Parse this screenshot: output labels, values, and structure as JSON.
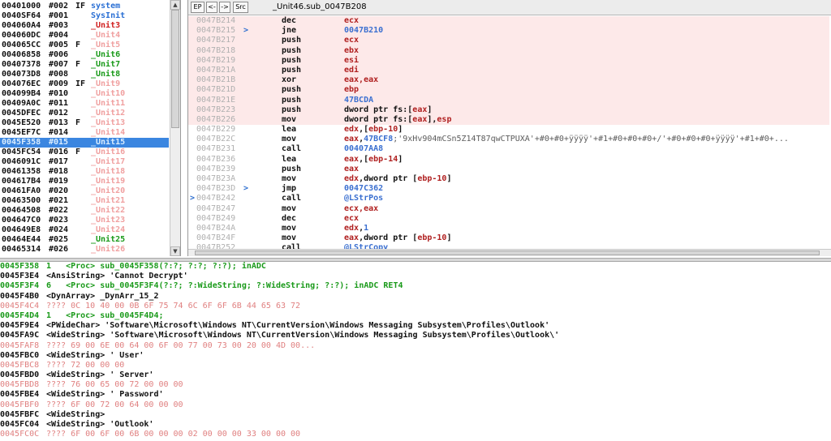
{
  "units": [
    {
      "addr": "00401000",
      "num": "#002",
      "flag": "IF",
      "name": "system",
      "color": "#2a6fd4"
    },
    {
      "addr": "0040SF64",
      "num": "#001",
      "flag": "",
      "name": "SysInit",
      "color": "#2a6fd4"
    },
    {
      "addr": "004060A4",
      "num": "#003",
      "flag": "",
      "name": "_Unit3",
      "color": "#d02020"
    },
    {
      "addr": "004060DC",
      "num": "#004",
      "flag": "",
      "name": "_Unit4",
      "color": "#f0a0a0"
    },
    {
      "addr": "004065CC",
      "num": "#005",
      "flag": "F",
      "name": "_Unit5",
      "color": "#f0a0a0"
    },
    {
      "addr": "00406858",
      "num": "#006",
      "flag": "",
      "name": "_Unit6",
      "color": "#1a9a1a"
    },
    {
      "addr": "00407378",
      "num": "#007",
      "flag": "F",
      "name": "_Unit7",
      "color": "#1a9a1a"
    },
    {
      "addr": "004073D8",
      "num": "#008",
      "flag": "",
      "name": "_Unit8",
      "color": "#1a9a1a"
    },
    {
      "addr": "004076EC",
      "num": "#009",
      "flag": "IF",
      "name": "_Unit9",
      "color": "#f0a0a0"
    },
    {
      "addr": "004099B4",
      "num": "#010",
      "flag": "",
      "name": "_Unit10",
      "color": "#f0a0a0"
    },
    {
      "addr": "00409A0C",
      "num": "#011",
      "flag": "",
      "name": "_Unit11",
      "color": "#f0a0a0"
    },
    {
      "addr": "0045DFEC",
      "num": "#012",
      "flag": "",
      "name": "_Unit12",
      "color": "#f0a0a0"
    },
    {
      "addr": "0045E520",
      "num": "#013",
      "flag": "F",
      "name": "_Unit13",
      "color": "#f0a0a0"
    },
    {
      "addr": "0045EF7C",
      "num": "#014",
      "flag": "",
      "name": "_Unit14",
      "color": "#f0a0a0"
    },
    {
      "addr": "0045F358",
      "num": "#015",
      "flag": "",
      "name": "_Unit15",
      "color": "#f0a0a0",
      "selected": true
    },
    {
      "addr": "0045FC54",
      "num": "#016",
      "flag": "F",
      "name": "_Unit16",
      "color": "#f0a0a0"
    },
    {
      "addr": "0046091C",
      "num": "#017",
      "flag": "",
      "name": "_Unit17",
      "color": "#f0a0a0"
    },
    {
      "addr": "00461358",
      "num": "#018",
      "flag": "",
      "name": "_Unit18",
      "color": "#f0a0a0"
    },
    {
      "addr": "004617B4",
      "num": "#019",
      "flag": "",
      "name": "_Unit19",
      "color": "#f0a0a0"
    },
    {
      "addr": "00461FA0",
      "num": "#020",
      "flag": "",
      "name": "_Unit20",
      "color": "#f0a0a0"
    },
    {
      "addr": "00463500",
      "num": "#021",
      "flag": "",
      "name": "_Unit21",
      "color": "#f0a0a0"
    },
    {
      "addr": "00464508",
      "num": "#022",
      "flag": "",
      "name": "_Unit22",
      "color": "#f0a0a0"
    },
    {
      "addr": "004647C0",
      "num": "#023",
      "flag": "",
      "name": "_Unit23",
      "color": "#f0a0a0"
    },
    {
      "addr": "004649E8",
      "num": "#024",
      "flag": "",
      "name": "_Unit24",
      "color": "#f0a0a0"
    },
    {
      "addr": "00464E44",
      "num": "#025",
      "flag": "",
      "name": "_Unit25",
      "color": "#1a9a1a"
    },
    {
      "addr": "00465314",
      "num": "#026",
      "flag": "",
      "name": "_Unit26",
      "color": "#f0a0a0"
    }
  ],
  "unit_scroll": {
    "thumb_start": 0.0,
    "thumb_size": 0.5,
    "up": "▲",
    "down": "▼"
  },
  "toolbar": {
    "buttons": [
      {
        "id": "ep",
        "label": "EP"
      },
      {
        "id": "back",
        "label": "<-"
      },
      {
        "id": "fwd",
        "label": "->"
      },
      {
        "id": "src",
        "label": "Src"
      }
    ],
    "title": "_Unit46.sub_0047B208"
  },
  "disasm": [
    {
      "addr": "0047B214",
      "jmp": "",
      "mnem": "dec",
      "op": [
        [
          "ecx",
          "reg"
        ]
      ],
      "hl": true
    },
    {
      "addr": "0047B215",
      "jmp": ">",
      "mnem": "jne",
      "op": [
        [
          "0047B210",
          "num"
        ]
      ],
      "hl": true
    },
    {
      "addr": "0047B217",
      "jmp": "",
      "mnem": "push",
      "op": [
        [
          "ecx",
          "reg"
        ]
      ],
      "hl": true
    },
    {
      "addr": "0047B218",
      "jmp": "",
      "mnem": "push",
      "op": [
        [
          "ebx",
          "reg"
        ]
      ],
      "hl": true
    },
    {
      "addr": "0047B219",
      "jmp": "",
      "mnem": "push",
      "op": [
        [
          "esi",
          "reg"
        ]
      ],
      "hl": true
    },
    {
      "addr": "0047B21A",
      "jmp": "",
      "mnem": "push",
      "op": [
        [
          "edi",
          "reg"
        ]
      ],
      "hl": true
    },
    {
      "addr": "0047B21B",
      "jmp": "",
      "mnem": "xor",
      "op": [
        [
          "eax,eax",
          "reg"
        ]
      ],
      "hl": true
    },
    {
      "addr": "0047B21D",
      "jmp": "",
      "mnem": "push",
      "op": [
        [
          "ebp",
          "reg"
        ]
      ],
      "hl": true
    },
    {
      "addr": "0047B21E",
      "jmp": "",
      "mnem": "push",
      "op": [
        [
          "47BCDA",
          "num"
        ]
      ],
      "hl": true
    },
    {
      "addr": "0047B223",
      "jmp": "",
      "mnem": "push",
      "op": [
        [
          "dword ptr fs:[",
          "plain"
        ],
        [
          "eax",
          "reg"
        ],
        [
          "]",
          "plain"
        ]
      ],
      "hl": true
    },
    {
      "addr": "0047B226",
      "jmp": "",
      "mnem": "mov",
      "op": [
        [
          "dword ptr fs:[",
          "plain"
        ],
        [
          "eax",
          "reg"
        ],
        [
          "],",
          "plain"
        ],
        [
          "esp",
          "reg"
        ]
      ],
      "hl": true
    },
    {
      "addr": "0047B229",
      "jmp": "",
      "mnem": "lea",
      "op": [
        [
          "edx",
          "reg"
        ],
        [
          ",[",
          "plain"
        ],
        [
          "ebp-10",
          "reg"
        ],
        [
          "]",
          "plain"
        ]
      ],
      "hl": false
    },
    {
      "addr": "0047B22C",
      "jmp": "",
      "mnem": "mov",
      "op": [
        [
          "eax",
          "reg"
        ],
        [
          ",",
          "plain"
        ],
        [
          "47BCF8",
          "num"
        ],
        [
          ";'9xHv904mCSn5Z14T87qwCTPUXA'+#0+#0+ÿÿÿÿ'+#1+#0+#0+#0+/'+#0+#0+#0+ÿÿÿÿ'+#1+#0+...",
          "str"
        ]
      ],
      "hl": false
    },
    {
      "addr": "0047B231",
      "jmp": "",
      "mnem": "call",
      "op": [
        [
          "00407AA8",
          "num"
        ]
      ],
      "hl": false
    },
    {
      "addr": "0047B236",
      "jmp": "",
      "mnem": "lea",
      "op": [
        [
          "eax",
          "reg"
        ],
        [
          ",[",
          "plain"
        ],
        [
          "ebp-14",
          "reg"
        ],
        [
          "]",
          "plain"
        ]
      ],
      "hl": false
    },
    {
      "addr": "0047B239",
      "jmp": "",
      "mnem": "push",
      "op": [
        [
          "eax",
          "reg"
        ]
      ],
      "hl": false
    },
    {
      "addr": "0047B23A",
      "jmp": "",
      "mnem": "mov",
      "op": [
        [
          "edx",
          "reg"
        ],
        [
          ",dword ptr [",
          "plain"
        ],
        [
          "ebp-10",
          "reg"
        ],
        [
          "]",
          "plain"
        ]
      ],
      "hl": false
    },
    {
      "addr": "0047B23D",
      "jmp": ">",
      "mnem": "jmp",
      "op": [
        [
          "0047C362",
          "num"
        ]
      ],
      "hl": false
    },
    {
      "addr": "0047B242",
      "jmp": "",
      "marker": ">",
      "mnem": "call",
      "op": [
        [
          "@LStrPos",
          "num"
        ]
      ],
      "hl": false
    },
    {
      "addr": "0047B247",
      "jmp": "",
      "mnem": "mov",
      "op": [
        [
          "ecx,eax",
          "reg"
        ]
      ],
      "hl": false
    },
    {
      "addr": "0047B249",
      "jmp": "",
      "mnem": "dec",
      "op": [
        [
          "ecx",
          "reg"
        ]
      ],
      "hl": false
    },
    {
      "addr": "0047B24A",
      "jmp": "",
      "mnem": "mov",
      "op": [
        [
          "edx",
          "reg"
        ],
        [
          ",",
          "plain"
        ],
        [
          "1",
          "num"
        ]
      ],
      "hl": false
    },
    {
      "addr": "0047B24F",
      "jmp": "",
      "mnem": "mov",
      "op": [
        [
          "eax",
          "reg"
        ],
        [
          ",dword ptr [",
          "plain"
        ],
        [
          "ebp-10",
          "reg"
        ],
        [
          "]",
          "plain"
        ]
      ],
      "hl": false
    },
    {
      "addr": "0047B252",
      "jmp": "",
      "mnem": "call",
      "op": [
        [
          "@LStrCopy",
          "num"
        ]
      ],
      "hl": false
    }
  ],
  "data_rows": [
    {
      "addr": "0045F358",
      "text": "1   <Proc> sub_0045F358(?:?; ?:?; ?:?); inADC",
      "kind": "proc"
    },
    {
      "addr": "0045F3E4",
      "text": "<AnsiString> 'Cannot Decrypt'",
      "kind": "normal"
    },
    {
      "addr": "0045F3F4",
      "text": "6   <Proc> sub_0045F3F4(?:?; ?:WideString; ?:WideString; ?:?); inADC RET4",
      "kind": "proc"
    },
    {
      "addr": "0045F4B0",
      "text": "<DynArray> _DynArr_15_2",
      "kind": "normal"
    },
    {
      "addr": "0045F4C4",
      "text": "???? 0C 10 40 00 0B 6F 75 74 6C 6F 6F 6B 44 65 63 72",
      "kind": "raw"
    },
    {
      "addr": "0045F4D4",
      "text": "1   <Proc> sub_0045F4D4;",
      "kind": "proc"
    },
    {
      "addr": "0045F9E4",
      "text": "<PWideChar> 'Software\\Microsoft\\Windows NT\\CurrentVersion\\Windows Messaging Subsystem\\Profiles\\Outlook'",
      "kind": "normal"
    },
    {
      "addr": "0045FA9C",
      "text": "<WideString> 'Software\\Microsoft\\Windows NT\\CurrentVersion\\Windows Messaging Subsystem\\Profiles\\Outlook\\'",
      "kind": "normal"
    },
    {
      "addr": "0045FAF8",
      "text": "???? 69 00 6E 00 64 00 6F 00 77 00 73 00 20 00 4D 00...",
      "kind": "raw"
    },
    {
      "addr": "0045FBC0",
      "text": "<WideString> ' User'",
      "kind": "normal"
    },
    {
      "addr": "0045FBC8",
      "text": "???? 72 00 00 00",
      "kind": "raw"
    },
    {
      "addr": "0045FBD0",
      "text": "<WideString> ' Server'",
      "kind": "normal"
    },
    {
      "addr": "0045FBD8",
      "text": "???? 76 00 65 00 72 00 00 00",
      "kind": "raw"
    },
    {
      "addr": "0045FBE4",
      "text": "<WideString> ' Password'",
      "kind": "normal"
    },
    {
      "addr": "0045FBF0",
      "text": "???? 6F 00 72 00 64 00 00 00",
      "kind": "raw"
    },
    {
      "addr": "0045FBFC",
      "text": "<WideString>",
      "kind": "normal"
    },
    {
      "addr": "0045FC04",
      "text": "<WideString> 'Outlook'",
      "kind": "normal"
    },
    {
      "addr": "0045FC0C",
      "text": "???? 6F 00 6F 00 6B 00 00 00 02 00 00 00 33 00 00 00",
      "kind": "raw"
    }
  ]
}
